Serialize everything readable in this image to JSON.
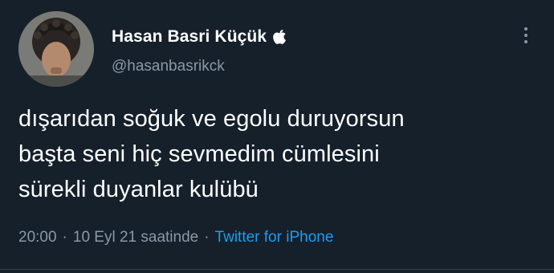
{
  "author": {
    "display_name": "Hasan Basri Küçük",
    "verified_icon": "apple-icon",
    "handle": "@hasanbasrikck",
    "avatar_icon": "avatar-photo"
  },
  "tweet": {
    "lines": [
      "dışarıdan soğuk ve egolu duruyorsun",
      "başta seni hiç sevmedim cümlesini",
      "sürekli duyanlar kulübü"
    ]
  },
  "meta": {
    "time": "20:00",
    "separator": "·",
    "date": "10 Eyl 21 saatinde",
    "source": "Twitter for iPhone"
  },
  "colors": {
    "background": "#15202b",
    "text": "#ffffff",
    "secondary": "#8b98a5",
    "accent": "#1d9bf0"
  },
  "icons": {
    "more": "more-vertical-icon"
  }
}
